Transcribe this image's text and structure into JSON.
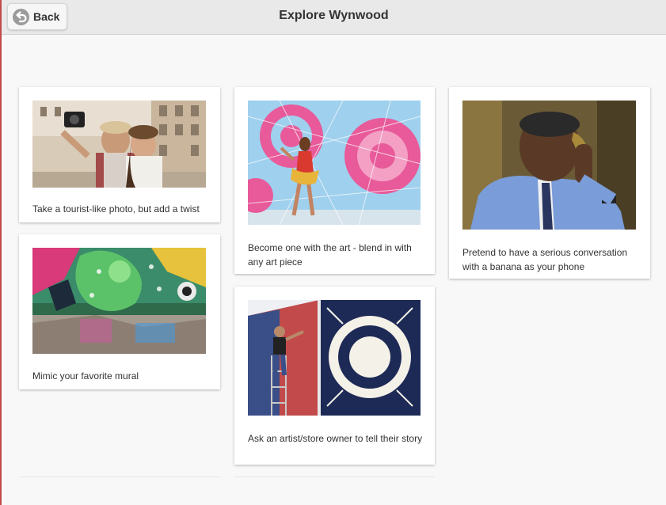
{
  "header": {
    "title": "Explore Wynwood",
    "back_label": "Back"
  },
  "cards": [
    {
      "caption": "Take a tourist-like photo, but add a twist",
      "image": "tourist-selfie-photo"
    },
    {
      "caption": "Mimic your favorite mural",
      "image": "colorful-mural-photo"
    },
    {
      "caption": "Become one with the art - blend in with any art piece",
      "image": "woman-mandala-wall-photo"
    },
    {
      "caption": "Ask an artist/store owner to tell their story",
      "image": "artist-painting-mural-photo"
    },
    {
      "caption": "Pretend to have a serious conversation with a banana as your phone",
      "image": "banana-phone-photo"
    }
  ],
  "colors": {
    "header_bg": "#e9e9e9",
    "accent_left_border": "#c04a4a",
    "page_bg": "#f8f8f8",
    "card_bg": "#ffffff"
  }
}
